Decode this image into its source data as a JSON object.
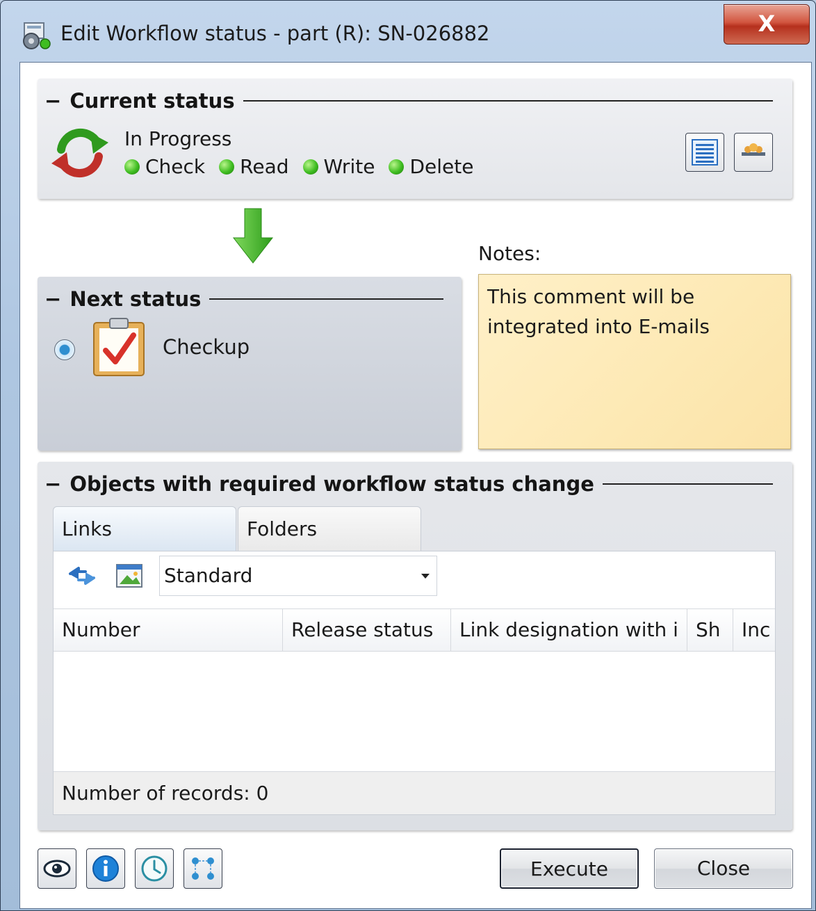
{
  "window": {
    "title": "Edit Workflow status - part (R): SN-026882",
    "close_label": "X"
  },
  "current_status": {
    "heading": "Current status",
    "name": "In Progress",
    "permissions": [
      {
        "label": "Check",
        "color": "#3fbd21"
      },
      {
        "label": "Read",
        "color": "#3fbd21"
      },
      {
        "label": "Write",
        "color": "#3fbd21"
      },
      {
        "label": "Delete",
        "color": "#3fbd21"
      }
    ],
    "tools": [
      "list-view-icon",
      "users-icon"
    ]
  },
  "next_status": {
    "heading": "Next status",
    "option": "Checkup",
    "selected": true
  },
  "notes": {
    "label": "Notes:",
    "value": "This comment will be\nintegrated into E-mails"
  },
  "objects": {
    "heading": "Objects with required workflow status change",
    "tabs": [
      {
        "label": "Links",
        "active": true
      },
      {
        "label": "Folders",
        "active": false
      }
    ],
    "view_select": "Standard",
    "columns": [
      "Number",
      "Release status",
      "Link designation with i",
      "Sh",
      "Inc"
    ],
    "rows": [],
    "record_count_text": "Number of records: 0"
  },
  "footer": {
    "icons": [
      "eye-icon",
      "info-icon",
      "clock-icon",
      "workflow-icon"
    ],
    "execute_label": "Execute",
    "close_label": "Close"
  },
  "colors": {
    "accent": "#2f8fd0",
    "status_green": "#3fbd21",
    "notes_bg": "#fde9b4",
    "close_red": "#c9452f"
  }
}
